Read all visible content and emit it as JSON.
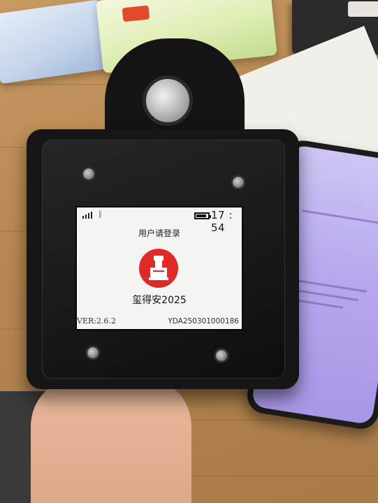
{
  "status_bar": {
    "time": "17 : 54",
    "battery_level": 0.9
  },
  "login": {
    "prompt": "用户请登录"
  },
  "app": {
    "name": "玺得安2025",
    "logo_color": "#e02a25"
  },
  "footer": {
    "version": "VER:2.6.2",
    "device_id": "YDA250301000186"
  },
  "icons": {
    "signal": "signal-bars-icon",
    "bluetooth": "bluetooth-icon",
    "battery": "battery-icon",
    "logo": "seal-stamp-icon"
  }
}
